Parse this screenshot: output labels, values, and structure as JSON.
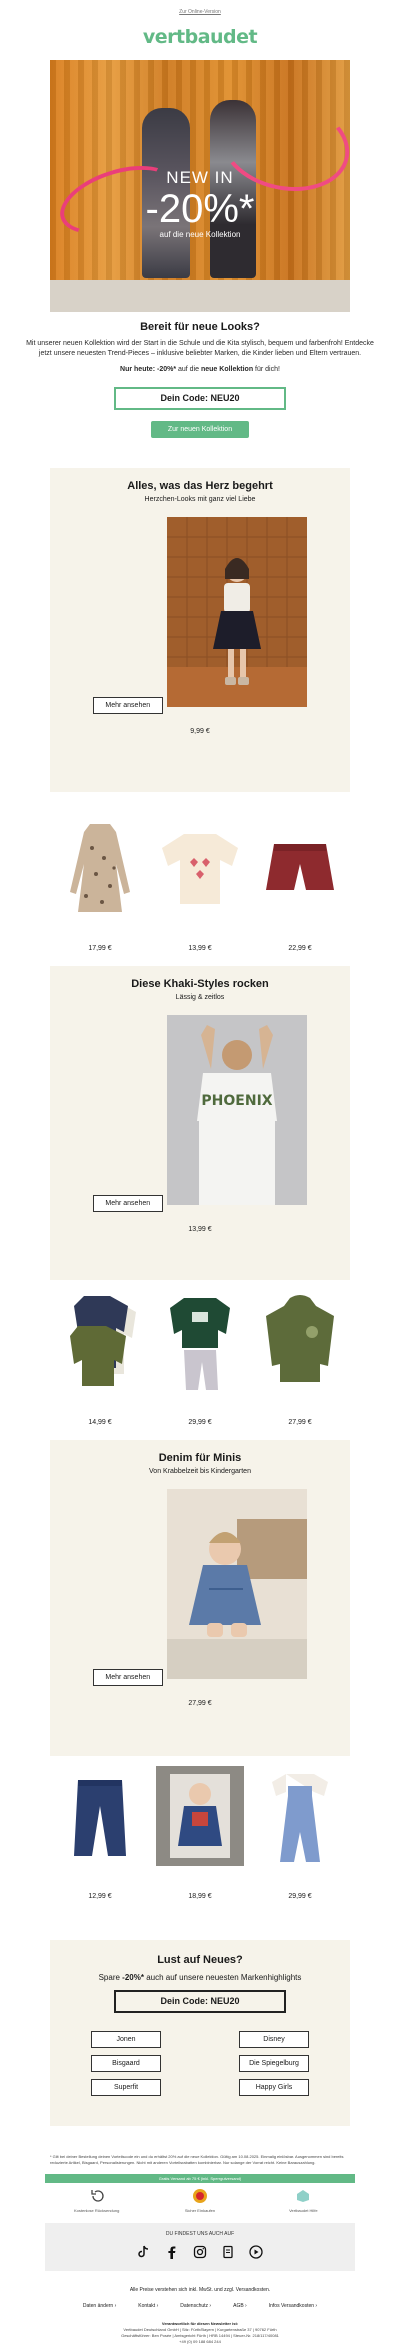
{
  "header": {
    "online_link": "Zur Online-Version",
    "logo": "vertbaudet"
  },
  "hero": {
    "title": "NEW IN",
    "discount": "-20%*",
    "subtitle": "auf die neue Kollektion"
  },
  "intro": {
    "heading": "Bereit für neue Looks?",
    "body": "Mit unserer neuen Kollektion wird der Start in die Schule und die Kita stylisch, bequem und farbenfroh! Entdecke jetzt unsere neuesten Trend-Pieces – inklusive beliebter Marken, die Kinder lieben und Eltern vertrauen.",
    "today_prefix": "Nur heute: ",
    "today_pct": "-20%*",
    "today_mid": " auf die ",
    "today_bold": "neue Kollektion",
    "today_suffix": " für dich!",
    "code": "Dein Code: NEU20",
    "cta": "Zur neuen Kollektion"
  },
  "sections": [
    {
      "title": "Alles, was das Herz begehrt",
      "subtitle": "Herzchen-Looks mit ganz viel Liebe",
      "button": "Mehr ansehen",
      "feature_price": "9,99 €",
      "products": [
        {
          "name": "leopard-dress",
          "price": "17,99 €"
        },
        {
          "name": "heart-sweater",
          "price": "13,99 €"
        },
        {
          "name": "red-shorts",
          "price": "22,99 €"
        }
      ]
    },
    {
      "title": "Diese Khaki-Styles rocken",
      "subtitle": "Lässig & zeitlos",
      "button": "Mehr ansehen",
      "feature_price": "13,99 €",
      "feature_print": "PHOENIX",
      "products": [
        {
          "name": "longsleeve-set",
          "price": "14,99 €"
        },
        {
          "name": "sport-set",
          "price": "29,99 €"
        },
        {
          "name": "khaki-hoodie",
          "price": "27,99 €"
        }
      ]
    },
    {
      "title": "Denim für Minis",
      "subtitle": "Von Krabbelzeit bis Kindergarten",
      "button": "Mehr ansehen",
      "feature_price": "27,99 €",
      "products": [
        {
          "name": "baby-jeans",
          "price": "12,99 €"
        },
        {
          "name": "baby-outfit",
          "price": "18,99 €"
        },
        {
          "name": "denim-dungaree",
          "price": "29,99 €"
        }
      ]
    }
  ],
  "brands": {
    "heading": "Lust auf Neues?",
    "save_prefix": "Spare ",
    "save_pct": "-20%*",
    "save_suffix": " auch auf unsere neuesten Markenhighlights",
    "code": "Dein Code: NEU20",
    "items": [
      "Jonen",
      "Disney",
      "Bisgaard",
      "Die Spiegelburg",
      "Superfit",
      "Happy Girls"
    ]
  },
  "footer": {
    "footnote": "* Gilt bei deiner Bestellung deinen Vorteilscode ein und du erhältst 20% auf die neue Kollektion. Gültig am 10.08.2025. Einmalig einlösbar. Ausgenommen sind bereits reduzierte Artikel, Bisgaard, Personalisierungen. Nicht mit anderen Vorteilsrabatten kombinierbar. Nur solange der Vorrat reicht. Keine Barauszahlung.",
    "shipping_bar": "Gratis Versand ab 75 € (inkl. Sperrgutversand)",
    "benefits": [
      "Kostenlose Rücksendung",
      "Sicher Einkaufen",
      "Vertbaudet Hilfe"
    ],
    "follow": "DU FINDEST UNS AUCH AUF",
    "prices_note": "Alle Preise verstehen sich inkl. MwSt. und zzgl. Versandkosten.",
    "links": [
      "Daten ändern ›",
      "Kontakt ›",
      "Datenschutz ›",
      "AGB ›",
      "Infos Versandkosten ›"
    ],
    "imprint_title": "Verantwortlich für diesen Newsletter ist:",
    "imprint_line1": "Vertbaudet Deutschland GmbH | Sitz: Fürth/Bayern | Kurgartenstraße 37 | 90762 Fürth",
    "imprint_line2": "Geschäftsführer: Ben Posée | Amtsgericht Fürth | HRB 14494 | Steuer-Nr. 218/117/40081",
    "imprint_line3": "+49 (0) 09 188 684 244"
  },
  "colors": {
    "brand_green": "#62b986",
    "beige": "#f6f3ea",
    "hero_orange": "#e08e2a",
    "ribbon_pink": "#ea3e7a"
  }
}
